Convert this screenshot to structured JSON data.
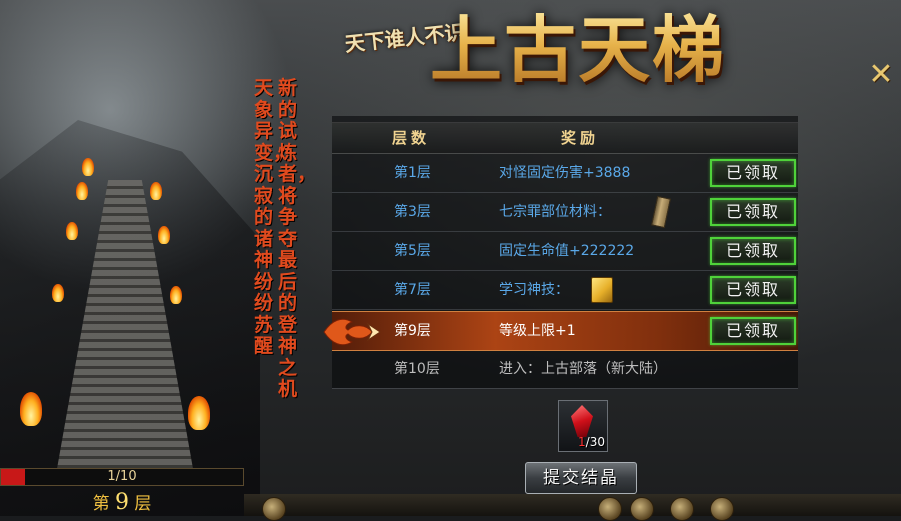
{
  "title": {
    "main": "上古天梯",
    "emblem": "天下谁人不识"
  },
  "close": {
    "glyph": "✕"
  },
  "lore": {
    "col1": "新的试炼者，将争夺最后的登神之机",
    "col2": "天象异变，沉寂的诸神纷纷苏醒"
  },
  "table": {
    "header_floor": "层数",
    "header_reward": "奖励",
    "rows": [
      {
        "floor": "第1层",
        "reward": "对怪固定伤害+3888",
        "button": "已领取",
        "item_icon": null,
        "state": "claimed"
      },
      {
        "floor": "第3层",
        "reward": "七宗罪部位材料：",
        "button": "已领取",
        "item_icon": "scroll-icon",
        "state": "claimed"
      },
      {
        "floor": "第5层",
        "reward": "固定生命值+222222",
        "button": "已领取",
        "item_icon": null,
        "state": "claimed"
      },
      {
        "floor": "第7层",
        "reward": "学习神技：",
        "button": "已领取",
        "item_icon": "book-icon",
        "state": "claimed"
      },
      {
        "floor": "第9层",
        "reward": "等级上限+1",
        "button": "已领取",
        "item_icon": null,
        "state": "current"
      },
      {
        "floor": "第10层",
        "reward": "进入：上古部落（新大陆）",
        "button": null,
        "item_icon": null,
        "state": "locked"
      }
    ]
  },
  "crystal": {
    "icon": "red-crystal-icon",
    "current": "1",
    "total": "30"
  },
  "submit_button": "提交结晶",
  "progress": {
    "text": "1/10",
    "value": 0.1
  },
  "current_floor": {
    "prefix": "第",
    "number": "9",
    "suffix": "层"
  },
  "colors": {
    "accent_gold": "#f0d390",
    "floor_blue": "#5aa8e8",
    "claim_green": "#4fd23a",
    "lore_red": "#e04a1e",
    "active_row": "#b4461a"
  }
}
